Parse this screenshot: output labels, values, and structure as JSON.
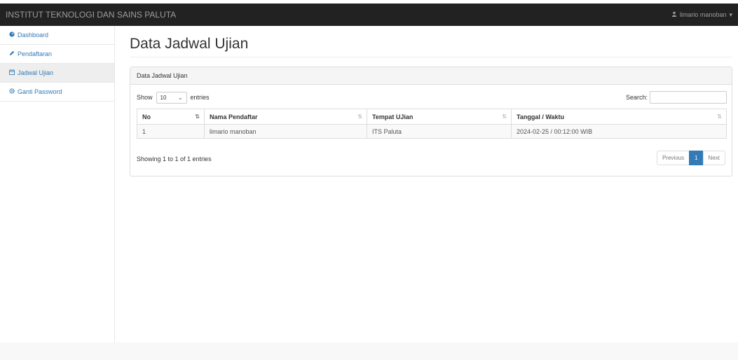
{
  "navbar": {
    "brand": "INSTITUT TEKNOLOGI DAN SAINS PALUTA",
    "user": "limario manoban",
    "user_icon": "user-icon"
  },
  "sidebar": {
    "items": [
      {
        "label": "Dashboard",
        "icon": "dashboard-icon"
      },
      {
        "label": "Pendaftaran",
        "icon": "pencil-icon"
      },
      {
        "label": "Jadwal Ujian",
        "icon": "calendar-icon",
        "active": true
      },
      {
        "label": "Ganti Password",
        "icon": "gear-icon"
      }
    ]
  },
  "page": {
    "title": "Data Jadwal Ujian"
  },
  "panel": {
    "heading": "Data Jadwal Ujian",
    "show_label": "Show",
    "entries_value": "10",
    "entries_label": "entries",
    "search_label": "Search:",
    "columns": [
      "No",
      "Nama Pendaftar",
      "Tempat UJian",
      "Tanggal / Waktu"
    ],
    "rows": [
      [
        "1",
        "limario manoban",
        "ITS Paluta",
        "2024-02-25 / 00:12:00 WIB"
      ]
    ],
    "info": "Showing 1 to 1 of 1 entries",
    "pagination": {
      "previous": "Previous",
      "current": "1",
      "next": "Next"
    }
  },
  "colors": {
    "navbar": "#222222",
    "link": "#337ab7",
    "active_page": "#337ab7"
  }
}
